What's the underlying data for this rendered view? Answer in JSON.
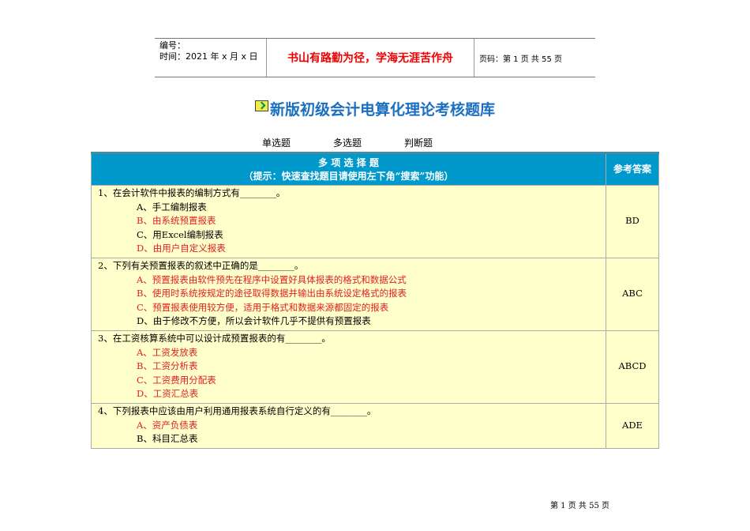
{
  "header": {
    "number_label": "编号：",
    "time_label": "时间：2021 年 x 月 x 日",
    "motto": "书山有路勤为径，学海无涯苦作舟",
    "page_code": "页码：第 1 页  共 55 页"
  },
  "title": "新版初级会计电算化理论考核题库",
  "nav": [
    "单选题",
    "多选题",
    "判断题"
  ],
  "table": {
    "heading": "多 项 选 择 题",
    "hint": "（提示：快速查找题目请使用左下角“搜索”功能）",
    "answer_header": "参考答案",
    "questions": [
      {
        "text": "1、在会计软件中报表的编制方式有________。",
        "options": [
          {
            "t": "A、手工编制报表",
            "c": false
          },
          {
            "t": "B、由系统预置报表",
            "c": true
          },
          {
            "t": "C、用Excel编制报表",
            "c": false
          },
          {
            "t": "D、由用户自定义报表",
            "c": true
          }
        ],
        "answer": "BD"
      },
      {
        "text": "2、下列有关预置报表的叙述中正确的是________。",
        "options": [
          {
            "t": "A、预置报表由软件预先在程序中设置好具体报表的格式和数据公式",
            "c": true
          },
          {
            "t": "B、使用时系统按规定的途径取得数据并输出由系统设定格式的报表",
            "c": true
          },
          {
            "t": "C、预置报表使用较方便，适用于格式和数据来源都固定的报表",
            "c": true
          },
          {
            "t": "D、由于修改不方便，所以会计软件几乎不提供有预置报表",
            "c": false
          }
        ],
        "answer": "ABC"
      },
      {
        "text": "3、在工资核算系统中可以设计成预置报表的有________。",
        "options": [
          {
            "t": "A、工资发放表",
            "c": true
          },
          {
            "t": "B、工资分析表",
            "c": true
          },
          {
            "t": "C、工资费用分配表",
            "c": true
          },
          {
            "t": "D、工资汇总表",
            "c": true
          }
        ],
        "answer": "ABCD"
      },
      {
        "text": "4、下列报表中应该由用户利用通用报表系统自行定义的有________。",
        "options": [
          {
            "t": "A、资产负债表",
            "c": true
          },
          {
            "t": "B、科目汇总表",
            "c": false
          }
        ],
        "answer": "ADE"
      }
    ]
  },
  "footer": "第 1 页 共 55 页",
  "colors": {
    "header_bg": "#0099cc",
    "row_bg": "#ffffcc",
    "correct": "#e02020",
    "title": "#1a6fc0"
  }
}
